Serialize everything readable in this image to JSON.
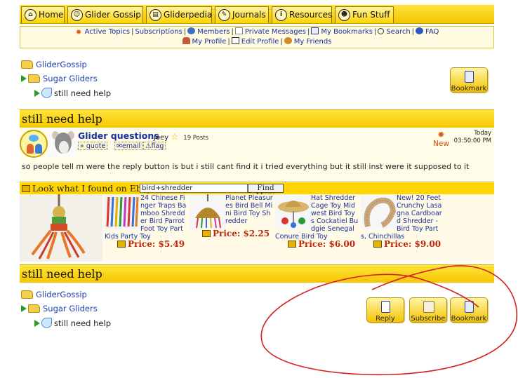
{
  "nav": {
    "tabs": [
      {
        "label": "Home",
        "icon": "home-icon"
      },
      {
        "label": "Glider Gossip",
        "icon": "people-icon"
      },
      {
        "label": "Gliderpedia",
        "icon": "book-icon"
      },
      {
        "label": "Journals",
        "icon": "pencil-icon"
      },
      {
        "label": "Resources",
        "icon": "info-icon"
      },
      {
        "label": "Fun Stuff",
        "icon": "smile-icon"
      }
    ]
  },
  "links": {
    "active_topics": "Active Topics",
    "subscriptions": "Subscriptions",
    "members": "Members",
    "private_messages": "Private Messages",
    "my_bookmarks": "My Bookmarks",
    "search": "Search",
    "faq": "FAQ",
    "my_profile": "My Profile",
    "edit_profile": "Edit Profile",
    "my_friends": "My Friends"
  },
  "breadcrumb": {
    "forum": "GliderGossip",
    "category": "Sugar Gliders",
    "topic": "still need help"
  },
  "buttons": {
    "bookmark": "Bookmark",
    "reply": "Reply",
    "subscribe": "Subscribe"
  },
  "topic": {
    "title": "still need help",
    "footer_title": "still need help"
  },
  "post": {
    "title": "Glider questions",
    "author": "Joey",
    "post_count": "19 Posts",
    "actions": {
      "quote": "quote",
      "email": "email",
      "flag": "flag"
    },
    "new_label": "New",
    "date": "Today",
    "time": "03:50:00 PM",
    "body": "so people tell m were the reply button is but i still cant find it i tried everything but it still inst were it supposed to it"
  },
  "ebay": {
    "heading": "Look what I found on Ebay",
    "search_value": "bird+shredder",
    "button": "Find More",
    "items": [
      {
        "title_lines": [
          "24 Chinese Fi",
          "nger Traps Ba",
          "mboo Shredd",
          "er Bird Parrot",
          "Foot Toy Part"
        ],
        "tail": "Kids Party Toy",
        "price": "$5.49"
      },
      {
        "title_lines": [
          "Planet Pleasur",
          "es Bird Bell Mi",
          "ni Bird Toy Sh",
          "redder"
        ],
        "tail": "",
        "price": "$2.25"
      },
      {
        "title_lines": [
          "Hat Shredder",
          "Cage Toy Mid",
          "west Bird Toy",
          "s Cockatiel Bu",
          "dgie Senegal"
        ],
        "tail": "Conure Bird Toy",
        "price": "$6.00"
      },
      {
        "title_lines": [
          "New! 20 Feet",
          "Crunchy Lasa",
          "gna Cardboar",
          "d Shredder -",
          "Bird Toy Part"
        ],
        "tail": "s, Chinchillas",
        "price": "$9.00"
      }
    ],
    "price_label": "Price:"
  },
  "colors": {
    "nav_yellow": "#ffd400",
    "link_blue": "#1a2fa0",
    "price_red": "#c0260c",
    "annotation_red": "#d42020"
  }
}
